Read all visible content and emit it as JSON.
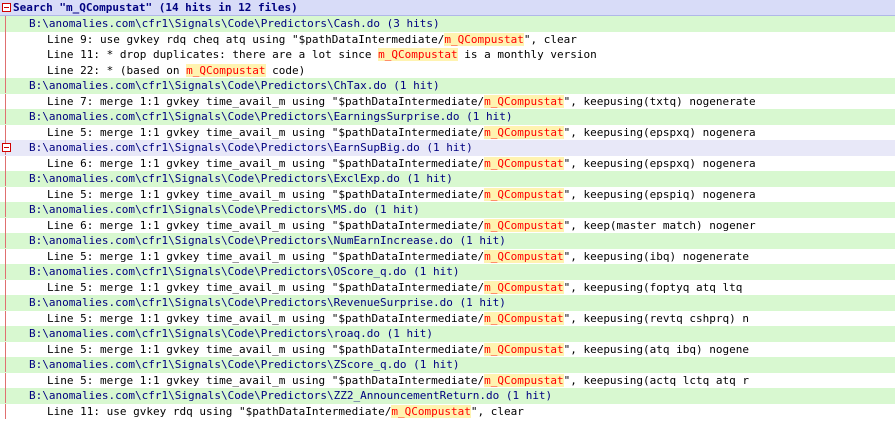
{
  "search_header": "Search \"m_QCompustat\" (14 hits in 12 files)",
  "search_term": "m_QCompustat",
  "colors": {
    "header_bg": "#d8dcf8",
    "file_bg": "#d8f8d0",
    "selected_file_bg": "#e8e8f8",
    "hit_text": "#ff0000",
    "hit_bg": "#fff3b0",
    "fold_marker": "#d00000"
  },
  "files": [
    {
      "path": "B:\\anomalies.com\\cfr1\\Signals\\Code\\Predictors\\Cash.do (3 hits)",
      "selected": false,
      "lines": [
        {
          "pre": "Line 9: use gvkey rdq cheq atq using \"$pathDataIntermediate/",
          "match": "m_QCompustat",
          "post": "\", clear"
        },
        {
          "pre": "Line 11: * drop duplicates: there are a lot since ",
          "match": "m_QCompustat",
          "post": " is a monthly version"
        },
        {
          "pre": "Line 22: * (based on ",
          "match": "m_QCompustat",
          "post": " code)"
        }
      ]
    },
    {
      "path": "B:\\anomalies.com\\cfr1\\Signals\\Code\\Predictors\\ChTax.do (1 hit)",
      "selected": false,
      "lines": [
        {
          "pre": "Line 7: merge 1:1 gvkey time_avail_m using \"$pathDataIntermediate/",
          "match": "m_QCompustat",
          "post": "\", keepusing(txtq) nogenerate"
        }
      ]
    },
    {
      "path": "B:\\anomalies.com\\cfr1\\Signals\\Code\\Predictors\\EarningsSurprise.do (1 hit)",
      "selected": false,
      "lines": [
        {
          "pre": "Line 5: merge 1:1 gvkey time_avail_m using \"$pathDataIntermediate/",
          "match": "m_QCompustat",
          "post": "\", keepusing(epspxq) nogenera"
        }
      ]
    },
    {
      "path": "B:\\anomalies.com\\cfr1\\Signals\\Code\\Predictors\\EarnSupBig.do (1 hit)",
      "selected": true,
      "lines": [
        {
          "pre": "Line 6: merge 1:1 gvkey time_avail_m using \"$pathDataIntermediate/",
          "match": "m_QCompustat",
          "post": "\", keepusing(epspxq) nogenera"
        }
      ]
    },
    {
      "path": "B:\\anomalies.com\\cfr1\\Signals\\Code\\Predictors\\ExclExp.do (1 hit)",
      "selected": false,
      "lines": [
        {
          "pre": "Line 5: merge 1:1 gvkey time_avail_m using \"$pathDataIntermediate/",
          "match": "m_QCompustat",
          "post": "\", keepusing(epspiq) nogenera"
        }
      ]
    },
    {
      "path": "B:\\anomalies.com\\cfr1\\Signals\\Code\\Predictors\\MS.do (1 hit)",
      "selected": false,
      "lines": [
        {
          "pre": "Line 6: merge 1:1 gvkey time_avail_m using \"$pathDataIntermediate/",
          "match": "m_QCompustat",
          "post": "\", keep(master match) nogener"
        }
      ]
    },
    {
      "path": "B:\\anomalies.com\\cfr1\\Signals\\Code\\Predictors\\NumEarnIncrease.do (1 hit)",
      "selected": false,
      "lines": [
        {
          "pre": "Line 5: merge 1:1 gvkey time_avail_m using \"$pathDataIntermediate/",
          "match": "m_QCompustat",
          "post": "\", keepusing(ibq) nogenerate"
        }
      ]
    },
    {
      "path": "B:\\anomalies.com\\cfr1\\Signals\\Code\\Predictors\\OScore_q.do (1 hit)",
      "selected": false,
      "lines": [
        {
          "pre": "Line 5: merge 1:1 gvkey time_avail_m using \"$pathDataIntermediate/",
          "match": "m_QCompustat",
          "post": "\", keepusing(foptyq atq ltq"
        }
      ]
    },
    {
      "path": "B:\\anomalies.com\\cfr1\\Signals\\Code\\Predictors\\RevenueSurprise.do (1 hit)",
      "selected": false,
      "lines": [
        {
          "pre": "Line 5: merge 1:1 gvkey time_avail_m using \"$pathDataIntermediate/",
          "match": "m_QCompustat",
          "post": "\", keepusing(revtq cshprq) n"
        }
      ]
    },
    {
      "path": "B:\\anomalies.com\\cfr1\\Signals\\Code\\Predictors\\roaq.do (1 hit)",
      "selected": false,
      "lines": [
        {
          "pre": "Line 5: merge 1:1 gvkey time_avail_m using \"$pathDataIntermediate/",
          "match": "m_QCompustat",
          "post": "\", keepusing(atq ibq) nogene"
        }
      ]
    },
    {
      "path": "B:\\anomalies.com\\cfr1\\Signals\\Code\\Predictors\\ZScore_q.do (1 hit)",
      "selected": false,
      "lines": [
        {
          "pre": "Line 5: merge 1:1 gvkey time_avail_m using \"$pathDataIntermediate/",
          "match": "m_QCompustat",
          "post": "\", keepusing(actq lctq atq r"
        }
      ]
    },
    {
      "path": "B:\\anomalies.com\\cfr1\\Signals\\Code\\Predictors\\ZZ2_AnnouncementReturn.do (1 hit)",
      "selected": false,
      "lines": [
        {
          "pre": "Line 11: use gvkey rdq using \"$pathDataIntermediate/",
          "match": "m_QCompustat",
          "post": "\", clear"
        }
      ]
    }
  ]
}
